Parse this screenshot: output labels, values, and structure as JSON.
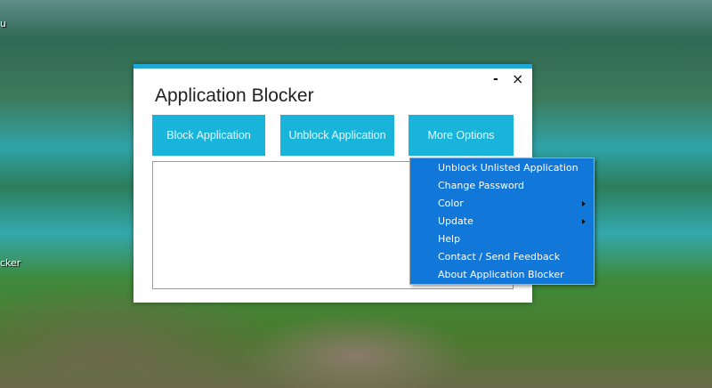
{
  "desktop": {
    "partial_icon_labels": [
      "u",
      "cker"
    ]
  },
  "window": {
    "title": "Application Blocker",
    "minimize": "-",
    "close": "×"
  },
  "buttons": {
    "block": "Block Application",
    "unblock": "Unblock Application",
    "more": "More Options"
  },
  "menu": {
    "items": [
      {
        "label": "Unblock Unlisted Application",
        "submenu": false
      },
      {
        "label": "Change Password",
        "submenu": false
      },
      {
        "label": "Color",
        "submenu": true
      },
      {
        "label": "Update",
        "submenu": true
      },
      {
        "label": "Help",
        "submenu": false
      },
      {
        "label": "Contact / Send Feedback",
        "submenu": false
      },
      {
        "label": "About Application Blocker",
        "submenu": false
      }
    ]
  },
  "colors": {
    "accent": "#1fa8d6",
    "button": "#18b4da",
    "menu": "#1177d8"
  }
}
